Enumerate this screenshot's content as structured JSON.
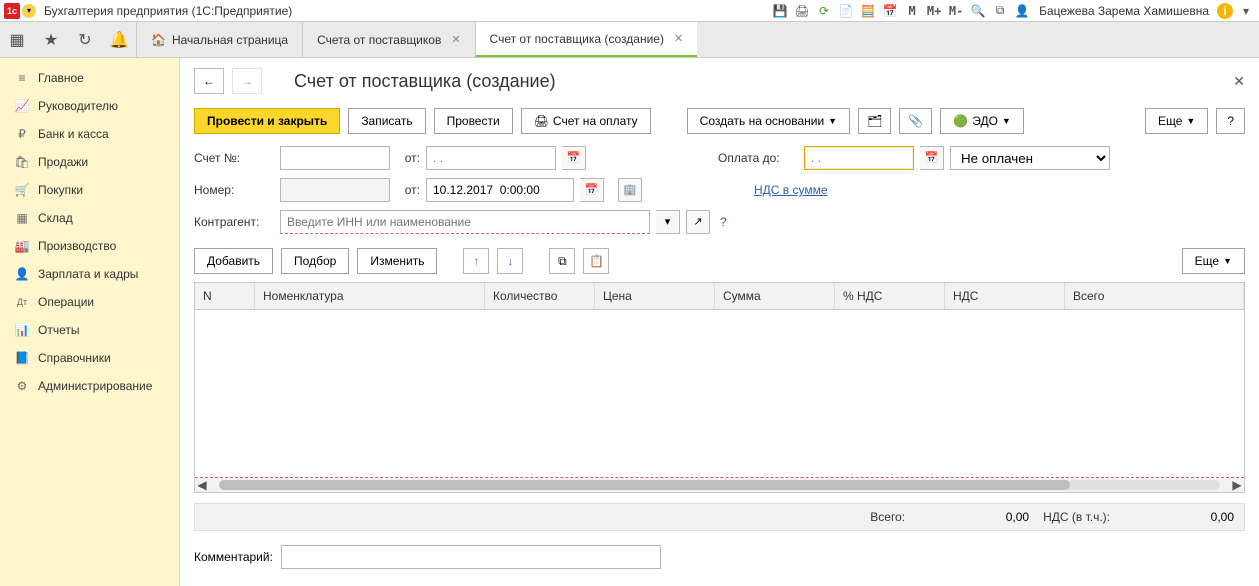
{
  "titlebar": {
    "title": "Бухгалтерия предприятия  (1С:Предприятие)",
    "user": "Бацежева Зарема Хамишевна",
    "mbtns": [
      "M",
      "M+",
      "M-"
    ]
  },
  "tabs": {
    "home": "Начальная страница",
    "t1": "Счета от поставщиков",
    "t2": "Счет от поставщика (создание)"
  },
  "sidebar": {
    "items": [
      {
        "icon": "≡",
        "label": "Главное"
      },
      {
        "icon": "📈",
        "label": "Руководителю"
      },
      {
        "icon": "₽",
        "label": "Банк и касса"
      },
      {
        "icon": "🛍",
        "label": "Продажи"
      },
      {
        "icon": "🛒",
        "label": "Покупки"
      },
      {
        "icon": "▦",
        "label": "Склад"
      },
      {
        "icon": "🏭",
        "label": "Производство"
      },
      {
        "icon": "👤",
        "label": "Зарплата и кадры"
      },
      {
        "icon": "Дт",
        "label": "Операции"
      },
      {
        "icon": "📊",
        "label": "Отчеты"
      },
      {
        "icon": "📘",
        "label": "Справочники"
      },
      {
        "icon": "⚙",
        "label": "Администрирование"
      }
    ]
  },
  "page": {
    "title": "Счет от поставщика (создание)"
  },
  "cmd": {
    "post_close": "Провести и закрыть",
    "write": "Записать",
    "post": "Провести",
    "print": "Счет на оплату",
    "create_based": "Создать на основании",
    "edo": "ЭДО",
    "more": "Еще",
    "help": "?"
  },
  "form": {
    "account_no_lbl": "Счет №:",
    "ot_lbl": "от:",
    "date_placeholder": ". .",
    "number_lbl": "Номер:",
    "number_date": "10.12.2017  0:00:00",
    "payment_until_lbl": "Оплата до:",
    "payment_status": "Не оплачен",
    "vat_link": "НДС в сумме",
    "contragent_lbl": "Контрагент:",
    "contragent_placeholder": "Введите ИНН или наименование"
  },
  "tblcmd": {
    "add": "Добавить",
    "select": "Подбор",
    "edit": "Изменить",
    "more": "Еще"
  },
  "cols": {
    "n": "N",
    "nomen": "Номенклатура",
    "qty": "Количество",
    "price": "Цена",
    "sum": "Сумма",
    "vat_rate": "% НДС",
    "vat": "НДС",
    "total": "Всего"
  },
  "totals": {
    "total_lbl": "Всего:",
    "total_val": "0,00",
    "vat_lbl": "НДС (в т.ч.):",
    "vat_val": "0,00"
  },
  "comment_lbl": "Комментарий:"
}
